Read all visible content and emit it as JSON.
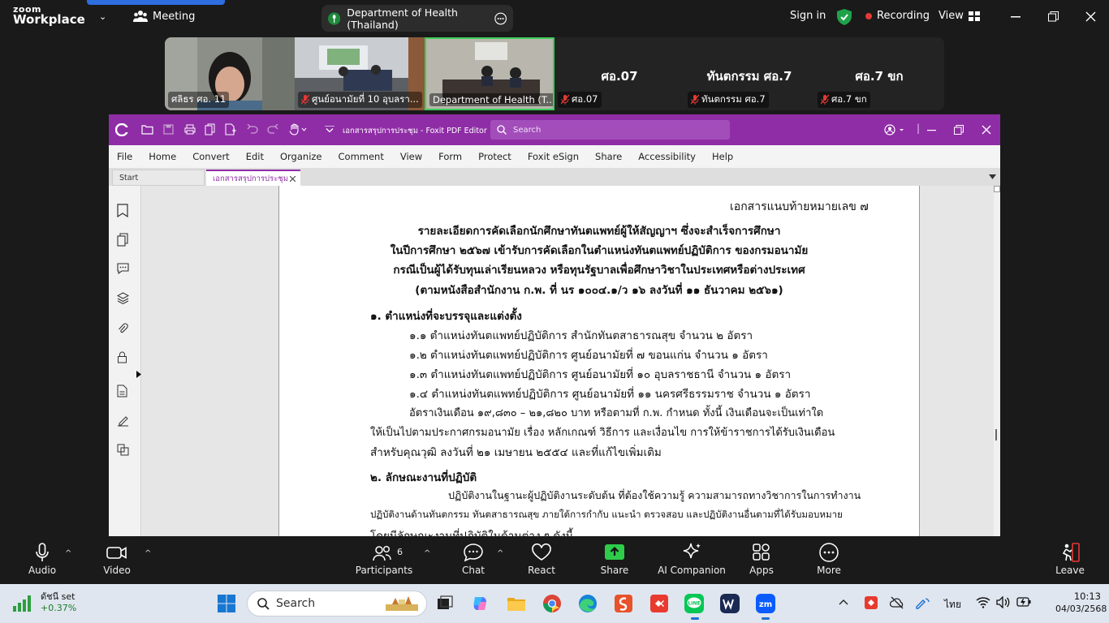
{
  "zoom": {
    "logo_line1": "zoom",
    "logo_line2": "Workplace",
    "meeting_label": "Meeting",
    "meeting_title": "Department of Health (Thailand)",
    "sign_in": "Sign in",
    "recording": "Recording",
    "view": "View",
    "tiles": [
      {
        "name": "ศลิธร ศอ. 11",
        "big": ""
      },
      {
        "name": "ศูนย์อนามัยที่ 10 อุบลรา...",
        "big": ""
      },
      {
        "name": "Department of Health (T...",
        "big": ""
      },
      {
        "name": "ศอ.07",
        "big": "ศอ.07"
      },
      {
        "name": "ทันตกรรม ศอ.7",
        "big": "ทันตกรรม ศอ.7"
      },
      {
        "name": "ศอ.7 ขก",
        "big": "ศอ.7 ขก"
      }
    ],
    "bottom": {
      "audio": "Audio",
      "video": "Video",
      "participants": "Participants",
      "participants_count": "6",
      "chat": "Chat",
      "react": "React",
      "share": "Share",
      "ai": "AI Companion",
      "apps": "Apps",
      "more": "More",
      "leave": "Leave"
    }
  },
  "foxit": {
    "title": "เอกสารสรุปการประชุม - Foxit PDF Editor",
    "search_placeholder": "Search",
    "menu": [
      "File",
      "Home",
      "Convert",
      "Edit",
      "Organize",
      "Comment",
      "View",
      "Form",
      "Protect",
      "Foxit eSign",
      "Share",
      "Accessibility",
      "Help"
    ],
    "tabs": [
      "Start",
      "เอกสารสรุปการประชุม"
    ]
  },
  "doc": {
    "annex": "เอกสารแนบท้ายหมายเลข ๗",
    "title1": "รายละเอียดการคัดเลือกนักศึกษาทันตแพทย์ผู้ให้สัญญาฯ ซึ่งจะสำเร็จการศึกษา",
    "title2": "ในปีการศึกษา ๒๕๖๗ เข้ารับการคัดเลือกในตำแหน่งทันตแพทย์ปฏิบัติการ ของกรมอนามัย",
    "title3": "กรณีเป็นผู้ได้รับทุนเล่าเรียนหลวง หรือทุนรัฐบาลเพื่อศึกษาวิชาในประเทศหรือต่างประเทศ",
    "title4": "(ตามหนังสือสำนักงาน ก.พ. ที่ นร ๑๐๐๔.๑/ว ๑๖ ลงวันที่ ๑๑ ธันวาคม ๒๕๖๑)",
    "sec1": "๑. ตำแหน่งที่จะบรรจุและแต่งตั้ง",
    "items": [
      "๑.๑ ตำแหน่งทันตแพทย์ปฏิบัติการ สำนักทันตสาธารณสุข จำนวน ๒ อัตรา",
      "๑.๒ ตำแหน่งทันตแพทย์ปฏิบัติการ ศูนย์อนามัยที่ ๗ ขอนแก่น จำนวน ๑ อัตรา",
      "๑.๓ ตำแหน่งทันตแพทย์ปฏิบัติการ ศูนย์อนามัยที่ ๑๐ อุบลราชธานี จำนวน ๑ อัตรา",
      "๑.๔ ตำแหน่งทันตแพทย์ปฏิบัติการ ศูนย์อนามัยที่ ๑๑ นครศรีธรรมราช จำนวน ๑ อัตรา"
    ],
    "salary1": "อัตราเงินเดือน ๑๙,๘๓๐ – ๒๑,๘๒๐ บาท หรือตามที่ ก.พ. กำหนด ทั้งนี้ เงินเดือนจะเป็นเท่าใด",
    "salary2": "ให้เป็นไปตามประกาศกรมอนามัย เรื่อง  หลักเกณฑ์ วิธีการ และเงื่อนไข การให้ข้าราชการได้รับเงินเดือน",
    "salary3": "สำหรับคุณวุฒิ ลงวันที่ ๒๑ เมษายน ๒๕๕๔  และที่แก้ไขเพิ่มเติม",
    "sec2": "๒. ลักษณะงานที่ปฏิบัติ",
    "work1": "ปฏิบัติงานในฐานะผู้ปฏิบัติงานระดับต้น ที่ต้องใช้ความรู้ ความสามารถทางวิชาการในการทำงาน",
    "work2": "ปฏิบัติงานด้านทันตกรรม ทันตสาธารณสุข ภายใต้การกำกับ แนะนำ ตรวจสอบ และปฏิบัติงานอื่นตามที่ได้รับมอบหมาย",
    "work3": "โดยมีลักษณะงานที่ปฏิบัติในด้านต่าง ๆ ดังนี้"
  },
  "taskbar": {
    "stock_name": "ดัชนี set",
    "stock_change": "+0.37%",
    "search": "Search",
    "lang": "ไทย",
    "time": "10:13",
    "date": "04/03/2568"
  }
}
